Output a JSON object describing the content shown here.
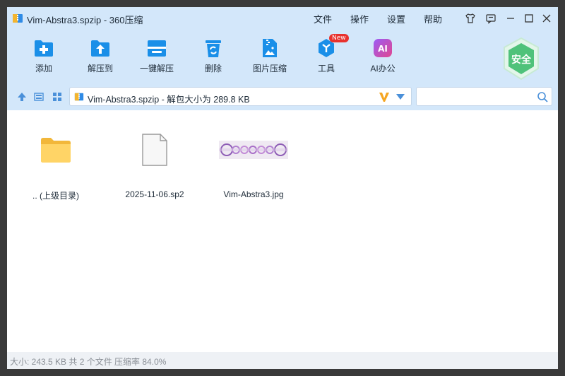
{
  "window": {
    "title": "Vim-Abstra3.spzip - 360压缩"
  },
  "menu": {
    "file": "文件",
    "operate": "操作",
    "settings": "设置",
    "help": "帮助"
  },
  "toolbar": {
    "items": [
      {
        "label": "添加",
        "icon": "add-icon"
      },
      {
        "label": "解压到",
        "icon": "extract-to-icon"
      },
      {
        "label": "一键解压",
        "icon": "one-click-extract-icon"
      },
      {
        "label": "删除",
        "icon": "delete-icon"
      },
      {
        "label": "图片压缩",
        "icon": "image-compress-icon"
      },
      {
        "label": "工具",
        "icon": "tools-icon",
        "badge": "New"
      },
      {
        "label": "AI办公",
        "icon": "ai-office-icon",
        "icon_text": "AI"
      }
    ],
    "security_label": "安全"
  },
  "address": {
    "path": "Vim-Abstra3.spzip - 解包大小为 289.8 KB"
  },
  "search": {
    "placeholder": "",
    "value": ""
  },
  "files": [
    {
      "name": ".. (上级目录)",
      "type": "folder"
    },
    {
      "name": "2025-11-06.sp2",
      "type": "document"
    },
    {
      "name": "Vim-Abstra3.jpg",
      "type": "image"
    }
  ],
  "status": {
    "text": "大小: 243.5 KB 共 2 个文件 压缩率 84.0%"
  },
  "colors": {
    "chrome_bg": "#d3e7fa",
    "accent_blue": "#1a8fe8",
    "badge_red": "#e8322e",
    "security_green": "#4fc27a"
  }
}
